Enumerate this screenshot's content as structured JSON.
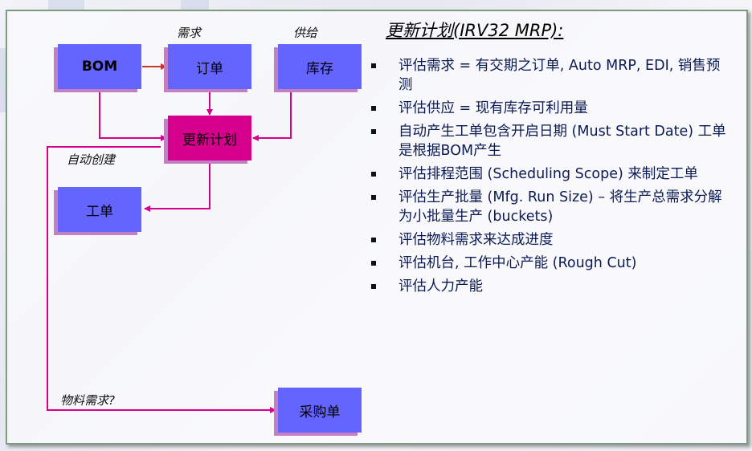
{
  "diagram": {
    "boxes": {
      "bom": "BOM",
      "order": "订单",
      "inventory": "库存",
      "update_plan": "更新计划",
      "work_order": "工单",
      "purchase_order": "采购单"
    },
    "labels": {
      "demand": "需求",
      "supply": "供给",
      "auto_create": "自动创建",
      "material_demand": "物料需求?"
    },
    "colors": {
      "box_fill": "#6464ff",
      "plan_fill": "#d6008c",
      "arrow": "#d6008c",
      "bom_to_order_arrow": "#c0392b"
    }
  },
  "panel": {
    "title": "更新计划(IRV32 MRP):",
    "bullets": [
      "评估需求 = 有交期之订单, Auto MRP, EDI, 销售预测",
      "评估供应 = 现有库存可利用量",
      "自动产生工单包含开启日期 (Must Start Date) 工单是根据BOM产生",
      "评估排程范围 (Scheduling Scope) 来制定工单",
      "评估生产批量 (Mfg. Run Size) – 将生产总需求分解为小批量生产 (buckets)",
      "评估物料需求来达成进度",
      "评估机台, 工作中心产能 (Rough Cut)",
      "评估人力产能"
    ]
  }
}
